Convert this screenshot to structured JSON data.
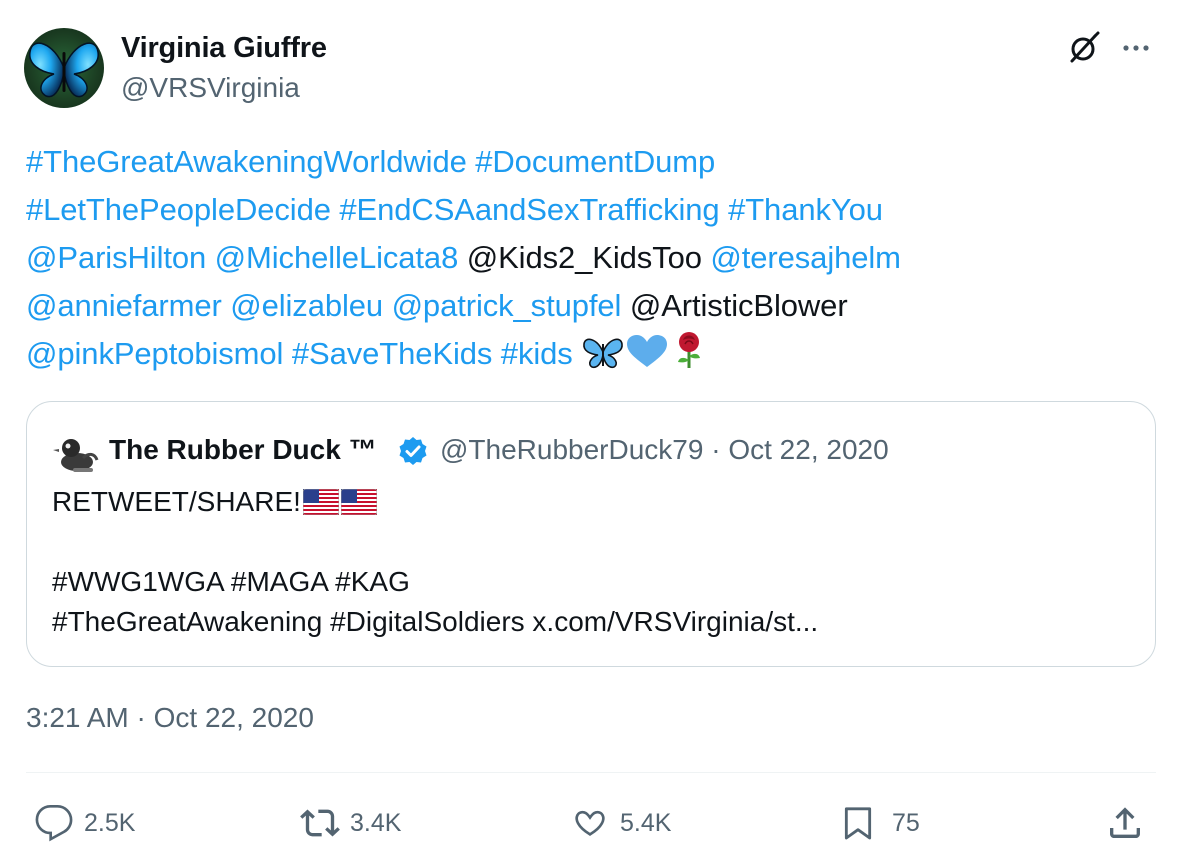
{
  "author": {
    "name": "Virginia Giuffre",
    "handle": "@VRSVirginia",
    "avatar_icon": "blue-butterfly-avatar"
  },
  "body_lines": [
    [
      {
        "text": "#TheGreatAwakeningWorldwide",
        "type": "hashtag"
      },
      {
        "text": " ",
        "type": "plain"
      },
      {
        "text": "#DocumentDump",
        "type": "hashtag"
      }
    ],
    [
      {
        "text": "#LetThePeopleDecide",
        "type": "hashtag"
      },
      {
        "text": " ",
        "type": "plain"
      },
      {
        "text": "#EndCSAandSexTrafficking",
        "type": "hashtag"
      },
      {
        "text": " ",
        "type": "plain"
      },
      {
        "text": "#ThankYou",
        "type": "hashtag"
      }
    ],
    [
      {
        "text": "@ParisHilton",
        "type": "mention"
      },
      {
        "text": " ",
        "type": "plain"
      },
      {
        "text": "@MichelleLicata8",
        "type": "mention"
      },
      {
        "text": " @Kids2_KidsToo ",
        "type": "plain"
      },
      {
        "text": "@teresajhelm",
        "type": "mention"
      }
    ],
    [
      {
        "text": "@anniefarmer",
        "type": "mention"
      },
      {
        "text": " ",
        "type": "plain"
      },
      {
        "text": "@elizableu",
        "type": "mention"
      },
      {
        "text": " ",
        "type": "plain"
      },
      {
        "text": "@patrick_stupfel",
        "type": "mention"
      },
      {
        "text": " @ArtisticBlower",
        "type": "plain"
      }
    ],
    [
      {
        "text": "@pinkPeptobismol",
        "type": "mention"
      },
      {
        "text": " ",
        "type": "plain"
      },
      {
        "text": "#SaveTheKids",
        "type": "hashtag"
      },
      {
        "text": " ",
        "type": "plain"
      },
      {
        "text": "#kids",
        "type": "hashtag"
      },
      {
        "text": " ",
        "type": "plain"
      }
    ]
  ],
  "body_emojis": [
    "butterfly-emoji",
    "blue-heart-emoji",
    "rose-emoji"
  ],
  "quote": {
    "name": "The Rubber Duck ™",
    "handle": "@TheRubberDuck79",
    "separator": "·",
    "date": "Oct 22, 2020",
    "verified_icon": "verified-badge-icon",
    "line1": "RETWEET/SHARE!",
    "line1_emojis": [
      "us-flag-emoji",
      "us-flag-emoji"
    ],
    "line2": "",
    "line3": "#WWG1WGA #MAGA #KAG",
    "line4": "#TheGreatAwakening #DigitalSoldiers x.com/VRSVirginia/st..."
  },
  "timestamp": "3:21 AM · Oct 22, 2020",
  "actions": {
    "replies": "2.5K",
    "retweets": "3.4K",
    "likes": "5.4K",
    "bookmarks": "75"
  },
  "colors": {
    "link": "#1d9bf0",
    "text": "#0f1419",
    "muted": "#536471",
    "border": "#cfd9de"
  }
}
